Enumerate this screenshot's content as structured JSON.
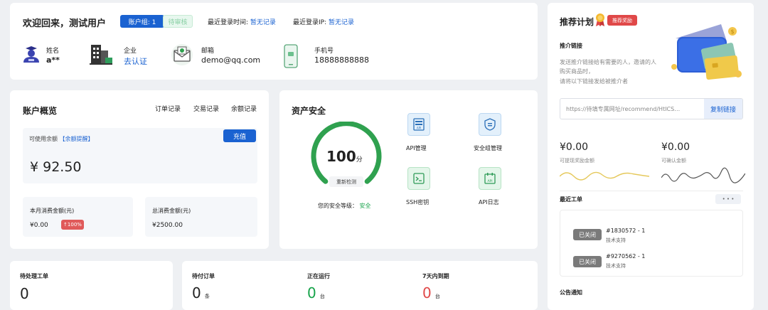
{
  "welcome": {
    "title": "欢迎回来，测试用户",
    "account_group_badge": "账户组: 1",
    "pending_badge": "待审核",
    "last_login_time_label": "最近登录时间:",
    "last_login_time_value": "暂无记录",
    "last_login_ip_label": "最近登录IP:",
    "last_login_ip_value": "暂无记录",
    "name_label": "姓名",
    "name_value": "a**",
    "company_label": "企业",
    "company_value": "去认证",
    "email_label": "邮箱",
    "email_value": "demo@qq.com",
    "phone_label": "手机号",
    "phone_value": "18888888888"
  },
  "overview": {
    "title": "账户概览",
    "links": [
      "订单记录",
      "交易记录",
      "余额记录"
    ],
    "available_label": "可使用余额",
    "balance_reminder": "【余额提醒】",
    "recharge_button": "充值",
    "balance": "¥ 92.50",
    "month_label": "本月消费金额(元)",
    "month_value": "¥0.00",
    "month_badge": "↑100%",
    "total_label": "总消费金额(元)",
    "total_value": "¥2500.00"
  },
  "security": {
    "title": "资产安全",
    "score": "100",
    "score_unit": "分",
    "score_fraction": 1.0,
    "recheck_label": "重新检测",
    "level_label": "您的安全等级：",
    "level_value": "安全",
    "items": [
      "API管理",
      "安全组管理",
      "SSH密钥",
      "API日志"
    ]
  },
  "stats": {
    "pending_tickets_label": "待处理工单",
    "pending_tickets_value": "0",
    "pending_orders_label": "待付订单",
    "pending_orders_value": "0",
    "pending_orders_unit": "条",
    "running_label": "正在运行",
    "running_value": "0",
    "running_unit": "台",
    "expiring_label": "7天内到期",
    "expiring_value": "0",
    "expiring_unit": "台"
  },
  "referral": {
    "title": "推荐计划",
    "badge": "推荐奖励",
    "link_title": "推介链接",
    "desc_line1": "发送推介链接给有需要的人，邀请的人",
    "desc_line2": "购买商品时，",
    "desc_line3": "请将以下链接发给被推介者",
    "link_value": "https://待填专属网址/recommend/HtICS…",
    "copy_button": "复制链接",
    "withdrawable_value": "¥0.00",
    "withdrawable_label": "可提现奖励金额",
    "pending_value": "¥0.00",
    "pending_label": "可确认金额"
  },
  "tickets": {
    "title": "最近工单",
    "more": "• • •",
    "items": [
      {
        "status": "已关闭",
        "id": "#1830572 - 1",
        "type": "技术支持"
      },
      {
        "status": "已关闭",
        "id": "#9270562 - 1",
        "type": "技术支持"
      }
    ]
  },
  "notice": {
    "title": "公告通知"
  },
  "colors": {
    "primary": "#1a62d1",
    "success": "#16a34a",
    "danger": "#e04848",
    "closed": "#7a7a7a"
  }
}
